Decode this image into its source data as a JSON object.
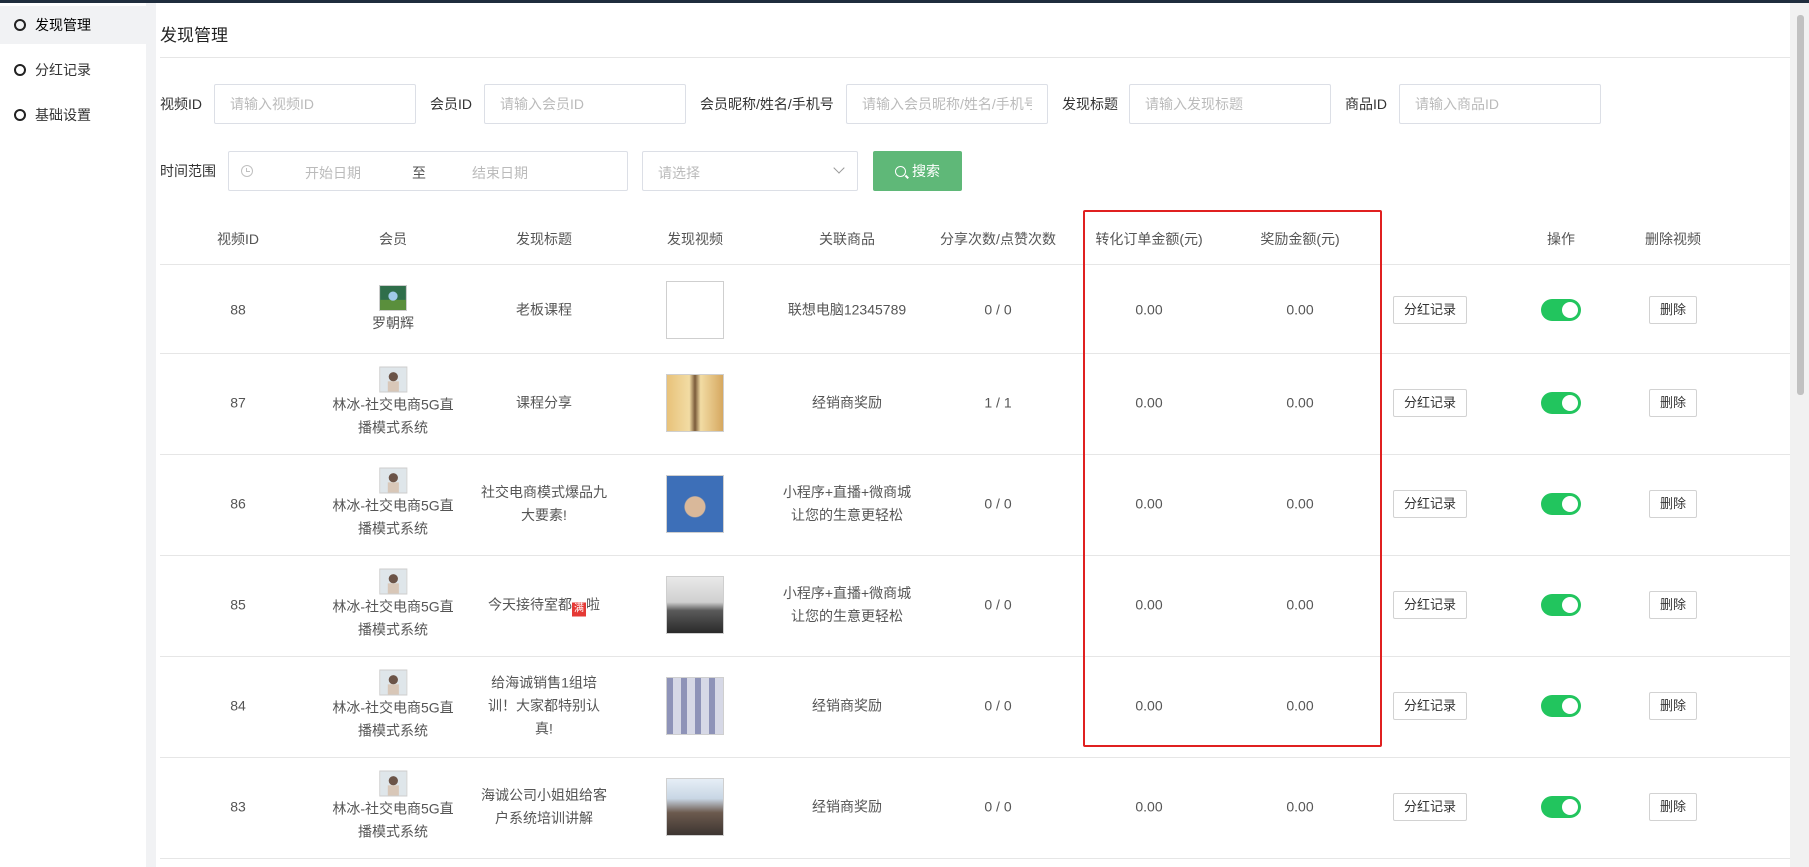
{
  "sidebar": {
    "items": [
      {
        "label": "发现管理",
        "active": true
      },
      {
        "label": "分红记录",
        "active": false
      },
      {
        "label": "基础设置",
        "active": false
      }
    ]
  },
  "page": {
    "title": "发现管理"
  },
  "filters": {
    "video_id": {
      "label": "视频ID",
      "placeholder": "请输入视频ID"
    },
    "member_id": {
      "label": "会员ID",
      "placeholder": "请输入会员ID"
    },
    "member_info": {
      "label": "会员昵称/姓名/手机号",
      "placeholder": "请输入会员昵称/姓名/手机号"
    },
    "title": {
      "label": "发现标题",
      "placeholder": "请输入发现标题"
    },
    "goods_id": {
      "label": "商品ID",
      "placeholder": "请输入商品ID"
    },
    "time_range": {
      "label": "时间范围",
      "start_placeholder": "开始日期",
      "separator": "至",
      "end_placeholder": "结束日期"
    },
    "select": {
      "placeholder": "请选择"
    },
    "search_button": "搜索"
  },
  "table": {
    "headers": [
      "视频ID",
      "会员",
      "发现标题",
      "发现视频",
      "关联商品",
      "分享次数/点赞次数",
      "转化订单金额(元)",
      "奖励金额(元)",
      "",
      "操作",
      "删除视频"
    ],
    "rows": [
      {
        "id": "88",
        "member": [
          "罗朝辉"
        ],
        "title": [
          "老板课程"
        ],
        "goods": [
          "联想电脑12345789"
        ],
        "stats": "0 / 0",
        "order_amount": "0.00",
        "reward": "0.00",
        "status_on": true
      },
      {
        "id": "87",
        "member": [
          "林冰-社交电商5G直",
          "播模式系统"
        ],
        "title": [
          "课程分享"
        ],
        "goods": [
          "经销商奖励"
        ],
        "stats": "1 / 1",
        "order_amount": "0.00",
        "reward": "0.00",
        "status_on": true
      },
      {
        "id": "86",
        "member": [
          "林冰-社交电商5G直",
          "播模式系统"
        ],
        "title": [
          "社交电商模式爆品九",
          "大要素!"
        ],
        "goods": [
          "小程序+直播+微商城",
          "让您的生意更轻松"
        ],
        "stats": "0 / 0",
        "order_amount": "0.00",
        "reward": "0.00",
        "status_on": true
      },
      {
        "id": "85",
        "member": [
          "林冰-社交电商5G直",
          "播模式系统"
        ],
        "title": [
          "今天接待室都",
          "啦"
        ],
        "goods": [
          "小程序+直播+微商城",
          "让您的生意更轻松"
        ],
        "stats": "0 / 0",
        "order_amount": "0.00",
        "reward": "0.00",
        "status_on": true
      },
      {
        "id": "84",
        "member": [
          "林冰-社交电商5G直",
          "播模式系统"
        ],
        "title": [
          "给海诚销售1组培",
          "训！大家都特别认",
          "真!"
        ],
        "goods": [
          "经销商奖励"
        ],
        "stats": "0 / 0",
        "order_amount": "0.00",
        "reward": "0.00",
        "status_on": true
      },
      {
        "id": "83",
        "member": [
          "林冰-社交电商5G直",
          "播模式系统"
        ],
        "title": [
          "海诚公司小姐姐给客",
          "户系统培训讲解"
        ],
        "goods": [
          "经销商奖励"
        ],
        "stats": "0 / 0",
        "order_amount": "0.00",
        "reward": "0.00",
        "status_on": true
      }
    ],
    "record_button": "分红记录",
    "delete_button": "删除",
    "emoji_mark": "满"
  },
  "colors": {
    "accent_green": "#5fb878",
    "switch_on": "#22c55e",
    "highlight_red": "#e02020"
  }
}
